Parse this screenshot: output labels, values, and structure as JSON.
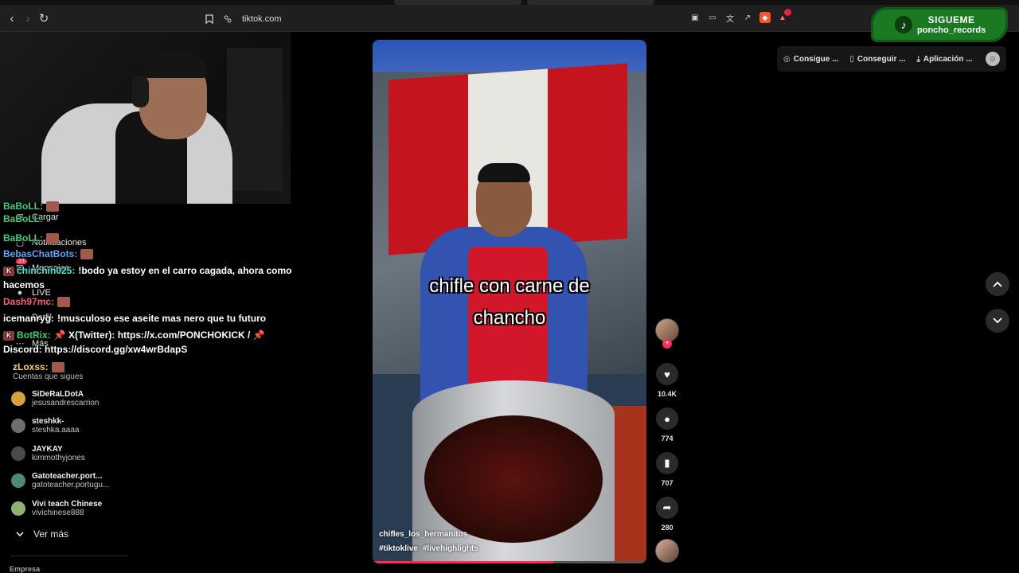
{
  "browser": {
    "url": "tiktok.com",
    "back_icon": "‹",
    "forward_icon": "›",
    "reload_icon": "↻"
  },
  "banner": {
    "line1": "SIGUEME",
    "line2": "poncho_records"
  },
  "top_pills": [
    {
      "label": "Consigue ...",
      "icon": "coin-icon"
    },
    {
      "label": "Conseguir ...",
      "icon": "phone-icon"
    },
    {
      "label": "Aplicación ...",
      "icon": "download-icon"
    }
  ],
  "sidebar": {
    "items": [
      {
        "label": "Cargar",
        "icon": "upload-icon"
      },
      {
        "label": "Notificaciones",
        "icon": "inbox-icon"
      },
      {
        "label": "Mensajes",
        "icon": "message-icon"
      },
      {
        "label": "LIVE",
        "icon": "live-icon"
      },
      {
        "label": "Perfil",
        "icon": "profile-icon"
      },
      {
        "label": "Más",
        "icon": "more-icon"
      }
    ],
    "notification_badge": "23",
    "following_title": "Cuentas que sigues",
    "following": [
      {
        "name": "SiDeRaLDotA",
        "handle": "jesusandrescarrion",
        "color": "#d9a13a"
      },
      {
        "name": "steshkk-",
        "handle": "steshka.aaaa",
        "color": "#6e6e6e"
      },
      {
        "name": "JAYKAY",
        "handle": "kimmothyjones",
        "color": "#4a4a4a"
      },
      {
        "name": "Gatoteacher.port...",
        "handle": "gatoteacher.portugu...",
        "color": "#4d8a6e"
      },
      {
        "name": "Vivi teach Chinese",
        "handle": "vivichinese888",
        "color": "#8fb36b"
      }
    ],
    "see_more": "Ver más",
    "footer_label": "Empresa"
  },
  "chat": {
    "lines": [
      {
        "user": "BaBoLL:",
        "color": "#3ad07a",
        "text": ""
      },
      {
        "user": "BaBoLL:",
        "color": "#3ad07a",
        "text": ""
      },
      {
        "user": "BebasChatBots:",
        "color": "#5aa6ff",
        "text": ""
      },
      {
        "user": "chinchin025:",
        "color": "#4de6d2",
        "text": "!bodo ya estoy en el carro cagada, ahora como hacemos"
      },
      {
        "user": "Dash97mc:",
        "color": "#ff5a6e",
        "text": ""
      },
      {
        "user": "icemanryg:",
        "color": "#ffffff",
        "text": "!musculoso ese aseite mas nero que tu futuro"
      },
      {
        "user": "BotRix:",
        "color": "#3ad07a",
        "text": "📌 X(Twitter): https://x.com/PONCHOKICK / 📌 Discord: https://discord.gg/xw4wrBdapS"
      },
      {
        "user": "zLoxss:",
        "color": "#ffd24a",
        "text": ""
      }
    ]
  },
  "video": {
    "caption_line1": "chifle con carne de",
    "caption_line2": "chancho",
    "author": "chifles_los_hermanitos",
    "tags": [
      "#tiktoklive",
      "#livehighlights"
    ],
    "progress": 0.66
  },
  "actions": {
    "likes": "10.4K",
    "comments": "774",
    "saves": "707",
    "shares": "280"
  },
  "colors": {
    "accent": "#fe2c55",
    "banner_green": "#1b7a21"
  }
}
